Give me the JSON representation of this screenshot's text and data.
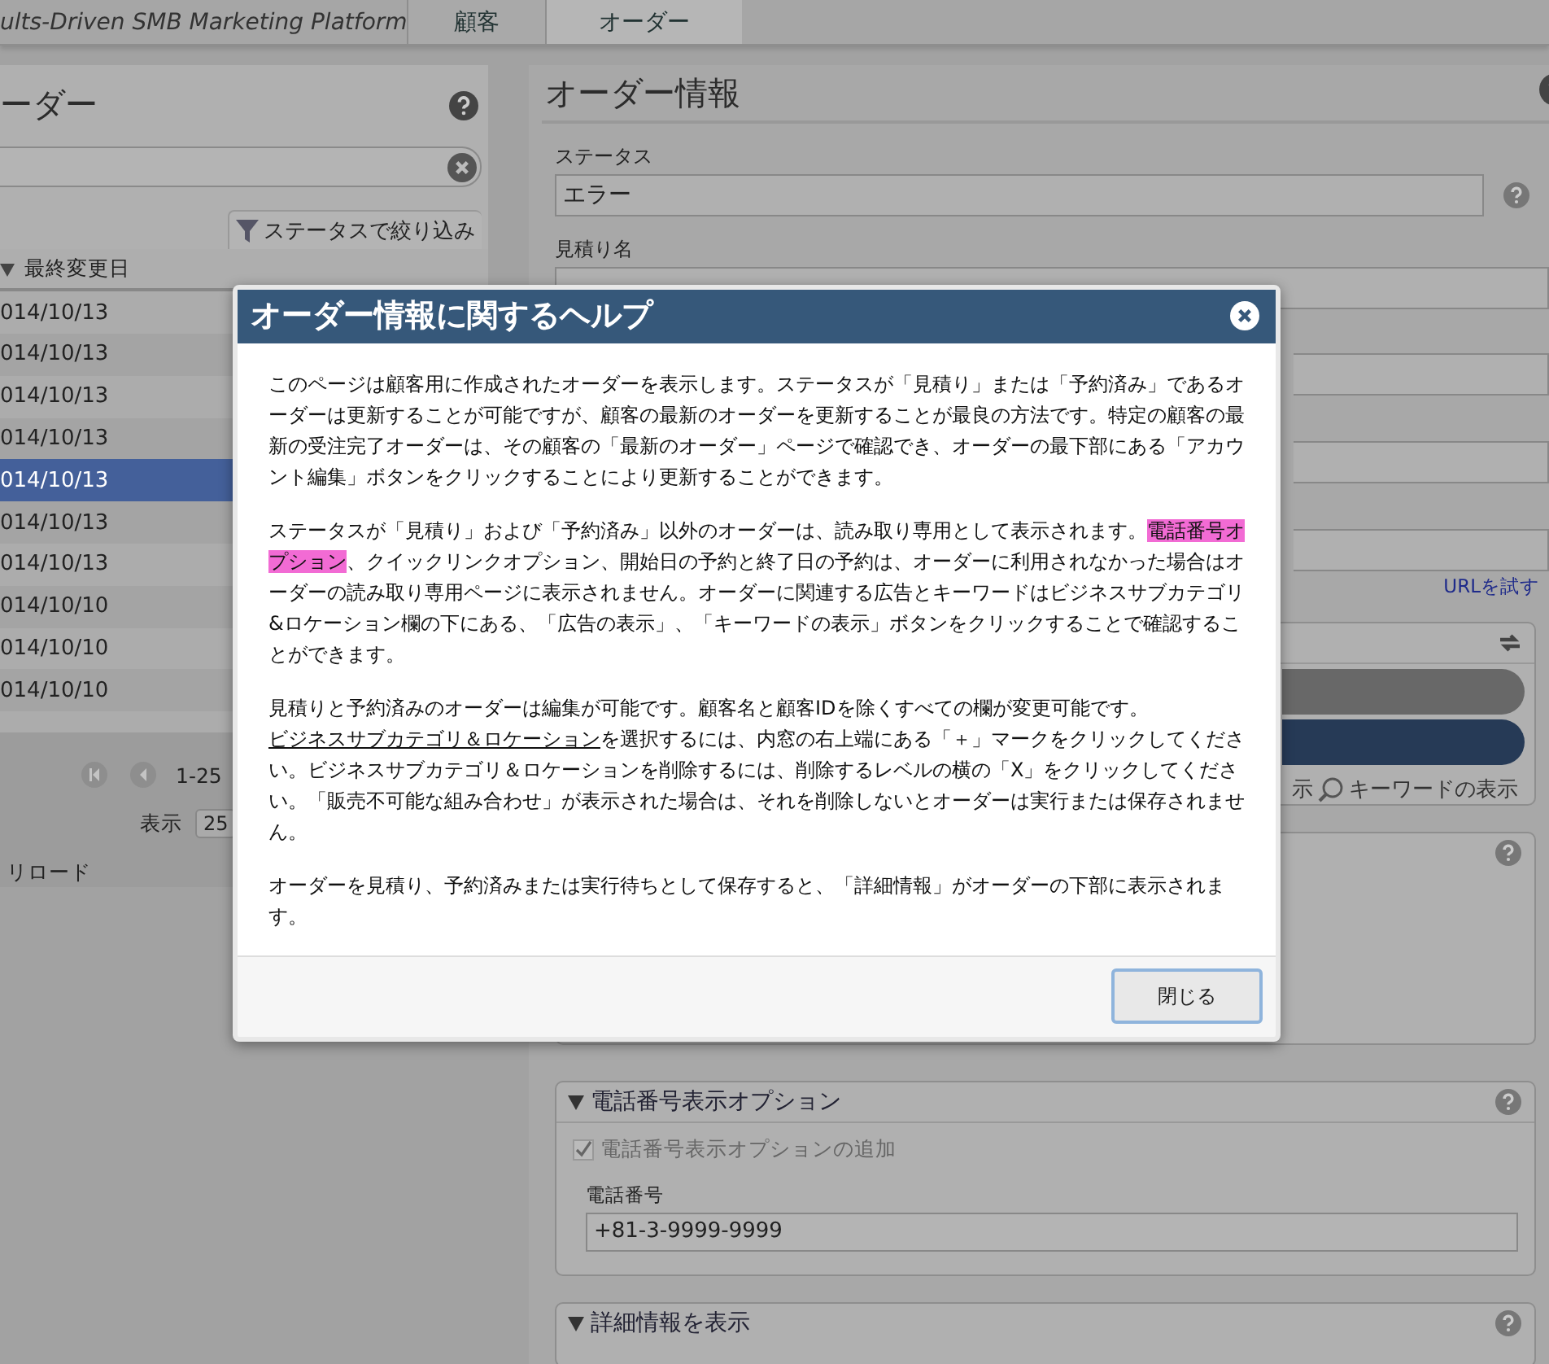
{
  "header": {
    "logo": "ults-Driven SMB Marketing Platform",
    "tabs": [
      {
        "label": "顧客",
        "selected": false
      },
      {
        "label": "オーダー",
        "selected": true
      }
    ]
  },
  "orders_panel": {
    "title": "ーダー",
    "filter_button": "ステータスで絞り込み",
    "date_column": "最終変更日",
    "rows": [
      {
        "date": "014/10/13",
        "selected": false
      },
      {
        "date": "014/10/13",
        "selected": false
      },
      {
        "date": "014/10/13",
        "selected": false
      },
      {
        "date": "014/10/13",
        "selected": false
      },
      {
        "date": "014/10/13",
        "selected": true
      },
      {
        "date": "014/10/13",
        "selected": false
      },
      {
        "date": "014/10/13",
        "selected": false
      },
      {
        "date": "014/10/10",
        "selected": false
      },
      {
        "date": "014/10/10",
        "selected": false
      },
      {
        "date": "014/10/10",
        "selected": false
      }
    ],
    "range": "1-25",
    "page_size_label": "表示",
    "page_size": "25",
    "reload": "リロード"
  },
  "order_info": {
    "title": "オーダー情報",
    "status_label": "ステータス",
    "status_value": "エラー",
    "estimate_label": "見積り名",
    "url_link": "URLを試す",
    "ads_button": "示",
    "keywords_button": "キーワードの表示",
    "phone_section": {
      "title": "電話番号表示オプション",
      "expanded": true,
      "checkbox": {
        "label": "電話番号表示オプションの追加",
        "checked": true,
        "disabled": true
      },
      "phone_label": "電話番号",
      "phone_value": "+81-3-9999-9999"
    },
    "details_section": {
      "title": "詳細情報を表示",
      "expanded": true
    }
  },
  "help_dialog": {
    "title": "オーダー情報に関するヘルプ",
    "paragraphs": [
      [
        {
          "kind": "plain",
          "text": "このページは顧客用に作成されたオーダーを表示します。ステータスが「見積り」または「予約済み」であるオーダーは更新することが可能ですが、顧客の最新のオーダーを更新することが最良の方法です。特定の顧客の最新の受注完了オーダーは、その顧客の「最新のオーダー」ページで確認でき、オーダーの最下部にある「アカウント編集」ボタンをクリックすることにより更新することができます。"
        }
      ],
      [
        {
          "kind": "plain",
          "text": "ステータスが「見積り」および「予約済み」以外のオーダーは、読み取り専用として表示されます。"
        },
        {
          "kind": "highlight",
          "text": "電話番号オプション"
        },
        {
          "kind": "plain",
          "text": "、クイックリンクオプション、開始日の予約と終了日の予約は、オーダーに利用されなかった場合はオーダーの読み取り専用ページに表示されません。オーダーに関連する広告とキーワードはビジネスサブカテゴリ&ロケーション欄の下にある、「広告の表示」、「キーワードの表示」ボタンをクリックすることで確認することができます。"
        }
      ],
      [
        {
          "kind": "plain",
          "text": "見積りと予約済みのオーダーは編集が可能です。顧客名と顧客IDを除くすべての欄が変更可能です。"
        },
        {
          "kind": "link",
          "text": "ビジネスサブカテゴリ＆ロケーション"
        },
        {
          "kind": "plain",
          "text": "を選択するには、内窓の右上端にある「＋」マークをクリックしてください。ビジネスサブカテゴリ＆ロケーションを削除するには、削除するレベルの横の「X」をクリックしてください。「販売不可能な組み合わせ」が表示された場合は、それを削除しないとオーダーは実行または保存されません。"
        }
      ],
      [
        {
          "kind": "plain",
          "text": "オーダーを見積り、予約済みまたは実行待ちとして保存すると、「詳細情報」がオーダーの下部に表示されます。"
        }
      ]
    ],
    "close_button": "閉じる"
  }
}
